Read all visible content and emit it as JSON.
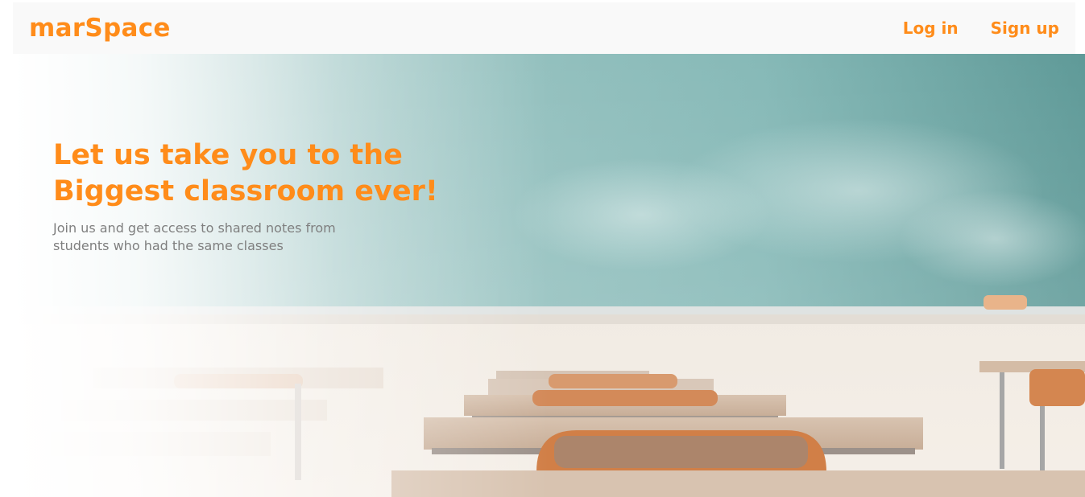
{
  "navbar": {
    "brand": "marSpace",
    "links": [
      {
        "label": "Log in"
      },
      {
        "label": "Sign up"
      }
    ]
  },
  "hero": {
    "title_line1": "Let us take you to the",
    "title_line2": "Biggest classroom ever!",
    "subtitle": "Join us and get access to shared notes from students who had the same classes",
    "background_image": "classroom with chalkboard and desks"
  },
  "colors": {
    "accent": "#ff8c1a",
    "navbar_bg": "#f9f9f9",
    "subtitle_text": "#7f7f7f",
    "chalkboard": "#7fb3b3"
  }
}
